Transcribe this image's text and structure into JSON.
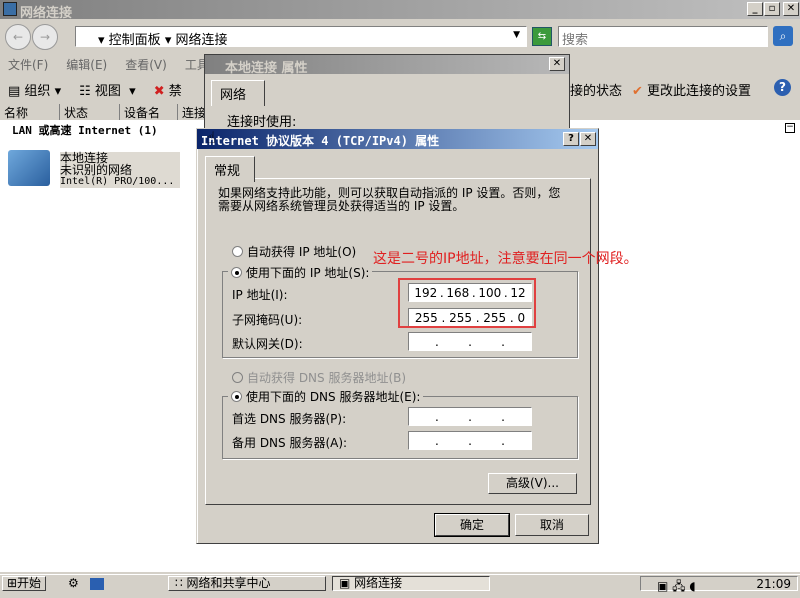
{
  "window": {
    "title": "网络连接"
  },
  "address": {
    "crumbs": [
      "控制面板",
      "网络连接"
    ],
    "search_placeholder": "搜索"
  },
  "menu": [
    "文件(F)",
    "编辑(E)",
    "查看(V)",
    "工具"
  ],
  "toolbar": {
    "organize": "组织",
    "views": "视图",
    "disable": "禁",
    "status": "接的状态",
    "change_settings": "更改此连接的设置"
  },
  "columns": [
    "名称",
    "状态",
    "设备名",
    "连接"
  ],
  "group_header": "LAN 或高速 Internet (1)",
  "connection": {
    "name": "本地连接",
    "network": "未识别的网络",
    "device": "Intel(R) PRO/100..."
  },
  "back_dialog": {
    "title": "本地连接 属性",
    "tab": "网络",
    "connect_using": "连接时使用:"
  },
  "dialog": {
    "title": "Internet 协议版本 4 (TCP/IPv4) 属性",
    "tab": "常规",
    "intro": "如果网络支持此功能，则可以获取自动指派的 IP 设置。否则，您需要从网络系统管理员处获得适当的 IP 设置。",
    "auto_ip": "自动获得 IP 地址(O)",
    "manual_ip": "使用下面的 IP 地址(S):",
    "ip_label": "IP 地址(I):",
    "ip_value": [
      "192",
      "168",
      "100",
      "12"
    ],
    "mask_label": "子网掩码(U):",
    "mask_value": [
      "255",
      "255",
      "255",
      "0"
    ],
    "gateway_label": "默认网关(D):",
    "auto_dns": "自动获得 DNS 服务器地址(B)",
    "manual_dns": "使用下面的 DNS 服务器地址(E):",
    "dns1_label": "首选 DNS 服务器(P):",
    "dns2_label": "备用 DNS 服务器(A):",
    "advanced": "高级(V)...",
    "ok": "确定",
    "cancel": "取消",
    "selected_ip_mode": "manual",
    "selected_dns_mode": "manual"
  },
  "annotation": {
    "text": "这是二号的IP地址，注意要在同一个网段。",
    "color": "#e02020"
  },
  "taskbar": {
    "start": "开始",
    "tasks": [
      "网络和共享中心",
      "网络连接"
    ],
    "clock": "21:09"
  }
}
